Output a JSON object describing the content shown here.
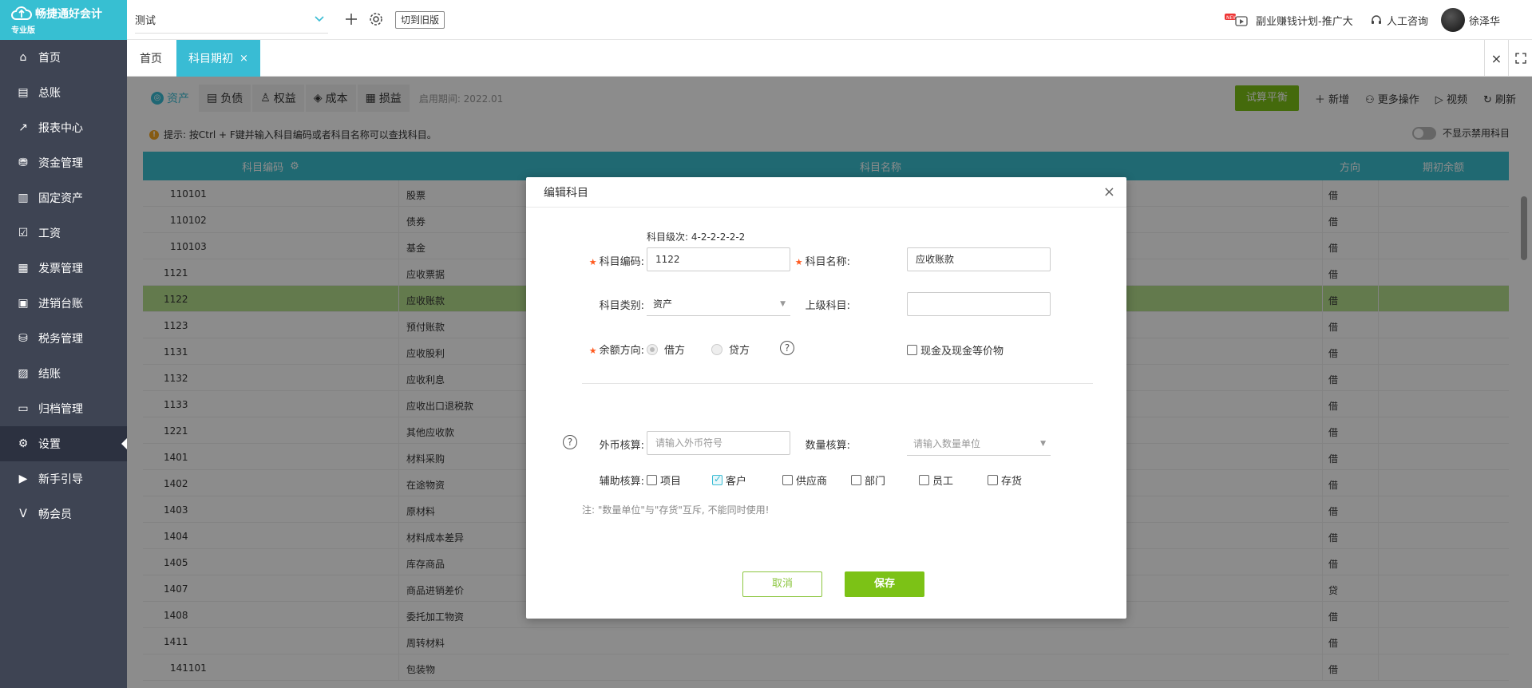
{
  "app": {
    "name": "畅捷通好会计",
    "edition": "专业版"
  },
  "sidebar": {
    "items": [
      {
        "label": "首页",
        "icon": "home-icon"
      },
      {
        "label": "总账",
        "icon": "ledger-icon"
      },
      {
        "label": "报表中心",
        "icon": "chart-icon"
      },
      {
        "label": "资金管理",
        "icon": "wallet-icon"
      },
      {
        "label": "固定资产",
        "icon": "building-icon"
      },
      {
        "label": "工资",
        "icon": "salary-icon"
      },
      {
        "label": "发票管理",
        "icon": "invoice-icon"
      },
      {
        "label": "进销台账",
        "icon": "inventory-icon"
      },
      {
        "label": "税务管理",
        "icon": "tax-icon"
      },
      {
        "label": "结账",
        "icon": "checkout-icon"
      },
      {
        "label": "归档管理",
        "icon": "archive-icon"
      },
      {
        "label": "设置",
        "icon": "gear-icon",
        "active": true
      },
      {
        "label": "新手引导",
        "icon": "play-icon"
      },
      {
        "label": "畅会员",
        "icon": "vip-icon"
      }
    ]
  },
  "topbar": {
    "account": "测试",
    "old_version": "切到旧版",
    "promo": "副业赚钱计划-推广大",
    "support": "人工咨询",
    "user": "徐泽华"
  },
  "tabs": {
    "home": "首页",
    "active": "科目期初"
  },
  "content": {
    "subtabs": [
      "资产",
      "负债",
      "权益",
      "成本",
      "损益"
    ],
    "start_period": "启用期间: 2022.01",
    "trial_balance": "试算平衡",
    "new": "新增",
    "more": "更多操作",
    "video": "视频",
    "refresh": "刷新",
    "tip": "提示: 按Ctrl + F键并输入科目编码或者科目名称可以查找科目。",
    "toggle_label": "不显示禁用科目",
    "columns": {
      "code": "科目编码",
      "name": "科目名称",
      "direction": "方向",
      "balance": "期初余额"
    },
    "rows": [
      {
        "code": "110101",
        "name": "股票",
        "dir": "借",
        "sub": true
      },
      {
        "code": "110102",
        "name": "债券",
        "dir": "借",
        "sub": true
      },
      {
        "code": "110103",
        "name": "基金",
        "dir": "借",
        "sub": true
      },
      {
        "code": "1121",
        "name": "应收票据",
        "dir": "借"
      },
      {
        "code": "1122",
        "name": "应收账款",
        "dir": "借",
        "hl": true
      },
      {
        "code": "1123",
        "name": "预付账款",
        "dir": "借"
      },
      {
        "code": "1131",
        "name": "应收股利",
        "dir": "借"
      },
      {
        "code": "1132",
        "name": "应收利息",
        "dir": "借"
      },
      {
        "code": "1133",
        "name": "应收出口退税款",
        "dir": "借"
      },
      {
        "code": "1221",
        "name": "其他应收款",
        "dir": "借"
      },
      {
        "code": "1401",
        "name": "材料采购",
        "dir": "借"
      },
      {
        "code": "1402",
        "name": "在途物资",
        "dir": "借"
      },
      {
        "code": "1403",
        "name": "原材料",
        "dir": "借"
      },
      {
        "code": "1404",
        "name": "材料成本差异",
        "dir": "借"
      },
      {
        "code": "1405",
        "name": "库存商品",
        "dir": "借"
      },
      {
        "code": "1407",
        "name": "商品进销差价",
        "dir": "贷"
      },
      {
        "code": "1408",
        "name": "委托加工物资",
        "dir": "借"
      },
      {
        "code": "1411",
        "name": "周转材料",
        "dir": "借"
      },
      {
        "code": "141101",
        "name": "包装物",
        "dir": "借",
        "sub": true
      }
    ]
  },
  "dialog": {
    "title": "编辑科目",
    "level_hint": "科目级次: 4-2-2-2-2-2",
    "code_label": "科目编码:",
    "code_value": "1122",
    "name_label": "科目名称:",
    "name_value": "应收账款",
    "type_label": "科目类别:",
    "type_value": "资产",
    "parent_label": "上级科目:",
    "parent_value": "",
    "balance_dir_label": "余额方向:",
    "debit": "借方",
    "credit": "贷方",
    "cash_equiv": "现金及现金等价物",
    "fx_label": "外币核算:",
    "fx_placeholder": "请输入外币符号",
    "qty_label": "数量核算:",
    "qty_placeholder": "请输入数量单位",
    "aux_label": "辅助核算:",
    "aux_items": [
      {
        "label": "项目",
        "checked": false
      },
      {
        "label": "客户",
        "checked": true
      },
      {
        "label": "供应商",
        "checked": false
      },
      {
        "label": "部门",
        "checked": false
      },
      {
        "label": "员工",
        "checked": false
      },
      {
        "label": "存货",
        "checked": false
      }
    ],
    "note": "注: \"数量单位\"与\"存货\"互斥, 不能同时使用!",
    "cancel": "取消",
    "save": "保存"
  },
  "colors": {
    "accent": "#39bcd4",
    "green": "#7cc216",
    "sidebar": "#3e4453"
  }
}
